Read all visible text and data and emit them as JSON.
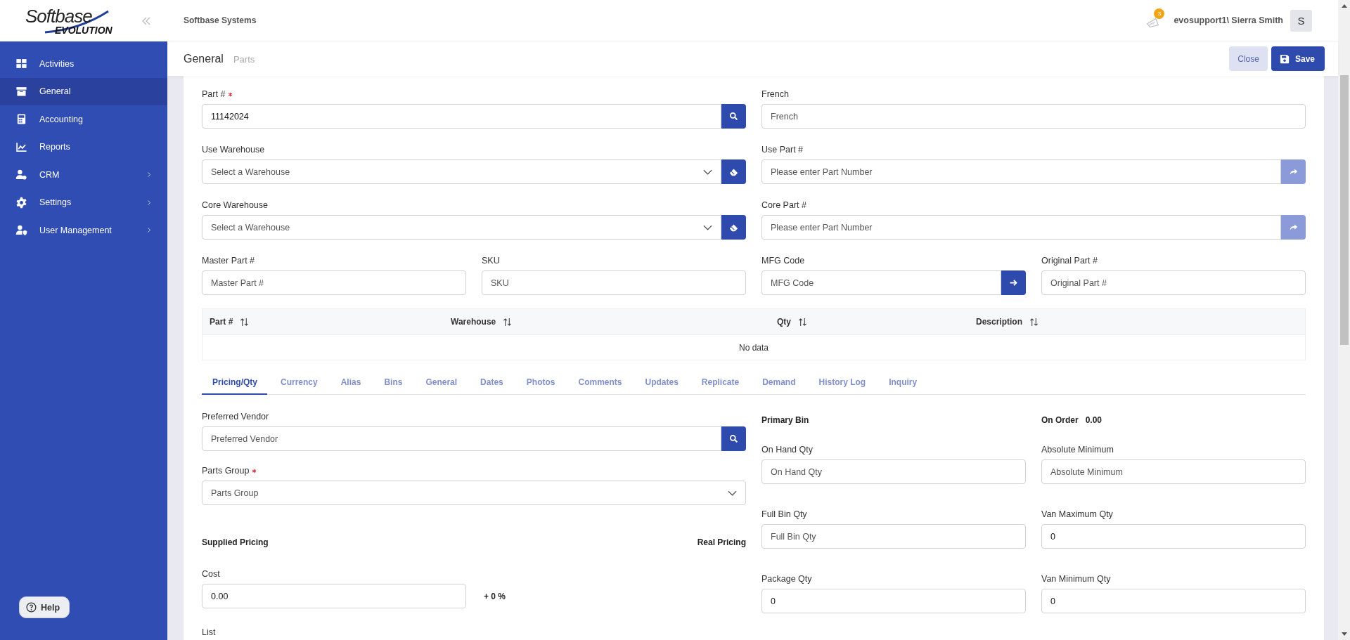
{
  "header": {
    "logo": {
      "title": "Softbase",
      "subtitle": "EVOLUTION"
    },
    "company": "Softbase Systems",
    "notifications": {
      "count": "3"
    },
    "user": "evosupport1\\ Sierra Smith",
    "avatar": "S"
  },
  "sidebar": {
    "items": [
      {
        "label": "Activities",
        "selected": false,
        "has_submenu": false
      },
      {
        "label": "General",
        "selected": true,
        "has_submenu": false
      },
      {
        "label": "Accounting",
        "selected": false,
        "has_submenu": false
      },
      {
        "label": "Reports",
        "selected": false,
        "has_submenu": false
      },
      {
        "label": "CRM",
        "selected": false,
        "has_submenu": true
      },
      {
        "label": "Settings",
        "selected": false,
        "has_submenu": true
      },
      {
        "label": "User Management",
        "selected": false,
        "has_submenu": true
      }
    ],
    "help": "Help"
  },
  "title": {
    "main": "General",
    "sub": "Parts"
  },
  "actions": [
    {
      "label": "Close",
      "kind": "secondary"
    },
    {
      "label": "Save",
      "kind": "primary"
    }
  ],
  "form": {
    "rows": [
      [
        {
          "label": "Part #",
          "required": true,
          "value": "11142024",
          "addon": {
            "kind": "search",
            "disabled": false
          }
        },
        {
          "label": "French",
          "placeholder": "French"
        }
      ],
      [
        {
          "label": "Use Warehouse",
          "placeholder": "Select a Warehouse",
          "dropdown": true,
          "addon": {
            "kind": "clear",
            "disabled": false
          }
        },
        {
          "label": "Use Part #",
          "placeholder": "Please enter Part Number",
          "addon": {
            "kind": "forward",
            "disabled": true
          }
        }
      ],
      [
        {
          "label": "Core Warehouse",
          "placeholder": "Select a Warehouse",
          "dropdown": true,
          "addon": {
            "kind": "clear",
            "disabled": false
          }
        },
        {
          "label": "Core Part #",
          "placeholder": "Please enter Part Number",
          "addon": {
            "kind": "forward",
            "disabled": true
          }
        }
      ],
      [
        {
          "label": "Master Part #",
          "placeholder": "Master Part #"
        },
        {
          "label": "SKU",
          "placeholder": "SKU"
        },
        {
          "label": "MFG Code",
          "placeholder": "MFG Code",
          "addon": {
            "kind": "arrow",
            "disabled": false
          }
        },
        {
          "label": "Original Part #",
          "placeholder": "Original Part #"
        }
      ]
    ]
  },
  "table": {
    "columns": [
      "Part #",
      "Warehouse",
      "Qty",
      "Description"
    ],
    "empty": "No data"
  },
  "tabs": [
    {
      "label": "Pricing/Qty",
      "selected": true
    },
    {
      "label": "Currency",
      "selected": false
    },
    {
      "label": "Alias",
      "selected": false
    },
    {
      "label": "Bins",
      "selected": false
    },
    {
      "label": "General",
      "selected": false
    },
    {
      "label": "Dates",
      "selected": false
    },
    {
      "label": "Photos",
      "selected": false
    },
    {
      "label": "Comments",
      "selected": false
    },
    {
      "label": "Updates",
      "selected": false
    },
    {
      "label": "Replicate",
      "selected": false
    },
    {
      "label": "Demand",
      "selected": false
    },
    {
      "label": "History Log",
      "selected": false
    },
    {
      "label": "Inquiry",
      "selected": false
    }
  ],
  "pricing": {
    "fields": [
      [
        {
          "label": "Preferred Vendor",
          "placeholder": "Preferred Vendor",
          "addon": {
            "kind": "search",
            "disabled": false
          }
        }
      ],
      [
        {
          "label": "Parts Group",
          "required": true,
          "placeholder": "Parts Group",
          "dropdown": true
        }
      ]
    ],
    "supplied_label": "Supplied Pricing",
    "real_label": "Real Pricing",
    "cost": {
      "label": "Cost",
      "value": "0.00",
      "markup": "+ 0 %"
    },
    "list_label": "List",
    "primary_bin": "Primary Bin",
    "on_order": {
      "label": "On Order",
      "value": "0.00"
    },
    "qty_rows": [
      [
        {
          "label": "On Hand Qty",
          "placeholder": "On Hand Qty"
        },
        {
          "label": "Absolute Minimum",
          "placeholder": "Absolute Minimum"
        }
      ],
      [
        {
          "label": "Full Bin Qty",
          "placeholder": "Full Bin Qty"
        },
        {
          "label": "Van Maximum Qty",
          "value": "0"
        }
      ],
      [
        {
          "label": "Package Qty",
          "value": "0"
        },
        {
          "label": "Van Minimum Qty",
          "value": "0"
        }
      ]
    ]
  }
}
